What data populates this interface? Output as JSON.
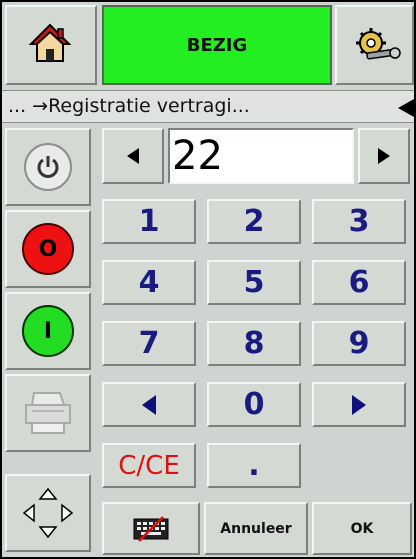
{
  "status": {
    "label": "BEZIG",
    "color": "#22ee22"
  },
  "breadcrumb": {
    "text": "... →Registratie vertragi..."
  },
  "entry": {
    "value": "22"
  },
  "keypad": {
    "k1": "1",
    "k2": "2",
    "k3": "3",
    "k4": "4",
    "k5": "5",
    "k6": "6",
    "k7": "7",
    "k8": "8",
    "k9": "9",
    "k0": "0",
    "clear": "C/CE",
    "dot": "."
  },
  "bottom": {
    "cancel": "Annuleer",
    "ok": "OK"
  },
  "icons": {
    "home": "home-icon",
    "tools": "tools-gear-icon",
    "power": "power-icon",
    "stop": "stop-icon",
    "start": "start-icon",
    "print": "printer-icon",
    "navigate": "navigate-arrows-icon",
    "keyboard": "keyboard-disabled-icon"
  },
  "left_buttons": {
    "stop_glyph": "O",
    "start_glyph": "I"
  }
}
